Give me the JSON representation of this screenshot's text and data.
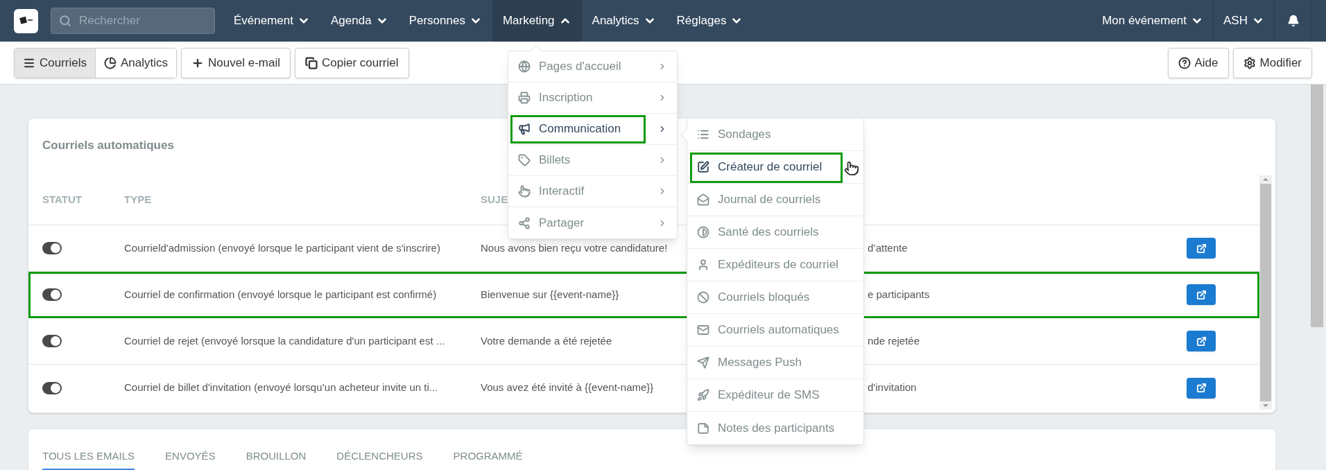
{
  "search": {
    "placeholder": "Rechercher"
  },
  "nav": [
    {
      "label": "Événement",
      "expanded": false
    },
    {
      "label": "Agenda",
      "expanded": false
    },
    {
      "label": "Personnes",
      "expanded": false
    },
    {
      "label": "Marketing",
      "expanded": true
    },
    {
      "label": "Analytics",
      "expanded": false
    },
    {
      "label": "Réglages",
      "expanded": false
    }
  ],
  "nav_right": [
    {
      "label": "Mon événement"
    },
    {
      "label": "ASH"
    }
  ],
  "toolbar": {
    "segments": [
      {
        "label": "Courriels",
        "selected": true
      },
      {
        "label": "Analytics",
        "selected": false
      }
    ],
    "buttons": [
      {
        "label": "Nouvel e-mail"
      },
      {
        "label": "Copier courriel"
      }
    ],
    "right_buttons": [
      {
        "label": "Aide"
      },
      {
        "label": "Modifier"
      }
    ]
  },
  "card": {
    "title": "Courriels automatiques",
    "columns": [
      "STATUT",
      "TYPE",
      "SUJE"
    ],
    "rows": [
      {
        "on": true,
        "type": "Courrield'admission (envoyé lorsque le participant vient de s'inscrire)",
        "subject": "Nous avons bien reçu votre candidature!",
        "column_4": "d’attente",
        "highlighted": false
      },
      {
        "on": true,
        "type": "Courriel de confirmation (envoyé lorsque le participant est confirmé)",
        "subject": "Bienvenue sur {{event-name}}",
        "column_4": "e participants",
        "highlighted": true
      },
      {
        "on": true,
        "type": "Courriel de rejet (envoyé lorsque la candidature d'un participant est ...",
        "subject": "Votre demande a été rejetée",
        "column_4": "nde rejetée",
        "highlighted": false
      },
      {
        "on": true,
        "type": "Courriel de billet d'invitation (envoyé lorsqu’un acheteur invite un ti...",
        "subject": "Vous avez été invité à {{event-name}}",
        "column_4": "d'invitation",
        "highlighted": false
      }
    ]
  },
  "bottom_tabs": [
    {
      "label": "TOUS LES EMAILS",
      "selected": true
    },
    {
      "label": "ENVOYÉS",
      "selected": false
    },
    {
      "label": "BROUILLON",
      "selected": false
    },
    {
      "label": "DÉCLENCHEURS",
      "selected": false
    },
    {
      "label": "PROGRAMMÉ",
      "selected": false
    }
  ],
  "menu": {
    "items": [
      {
        "label": "Pages d'accueil",
        "selected": false
      },
      {
        "label": "Inscription",
        "selected": false
      },
      {
        "label": "Communication",
        "selected": true
      },
      {
        "label": "Billets",
        "selected": false
      },
      {
        "label": "Interactif",
        "selected": false
      },
      {
        "label": "Partager",
        "selected": false
      }
    ]
  },
  "submenu": {
    "items": [
      {
        "label": "Sondages",
        "selected": false
      },
      {
        "label": "Créateur de courriel",
        "selected": true
      },
      {
        "label": "Journal de courriels",
        "selected": false
      },
      {
        "label": "Santé des courriels",
        "selected": false
      },
      {
        "label": "Expéditeurs de courriel",
        "selected": false
      },
      {
        "label": "Courriels bloqués",
        "selected": false
      },
      {
        "label": "Courriels automatiques",
        "selected": false
      },
      {
        "label": "Messages Push",
        "selected": false
      },
      {
        "label": "Expéditeur de SMS",
        "selected": false
      },
      {
        "label": "Notes des participants",
        "selected": false
      }
    ]
  }
}
